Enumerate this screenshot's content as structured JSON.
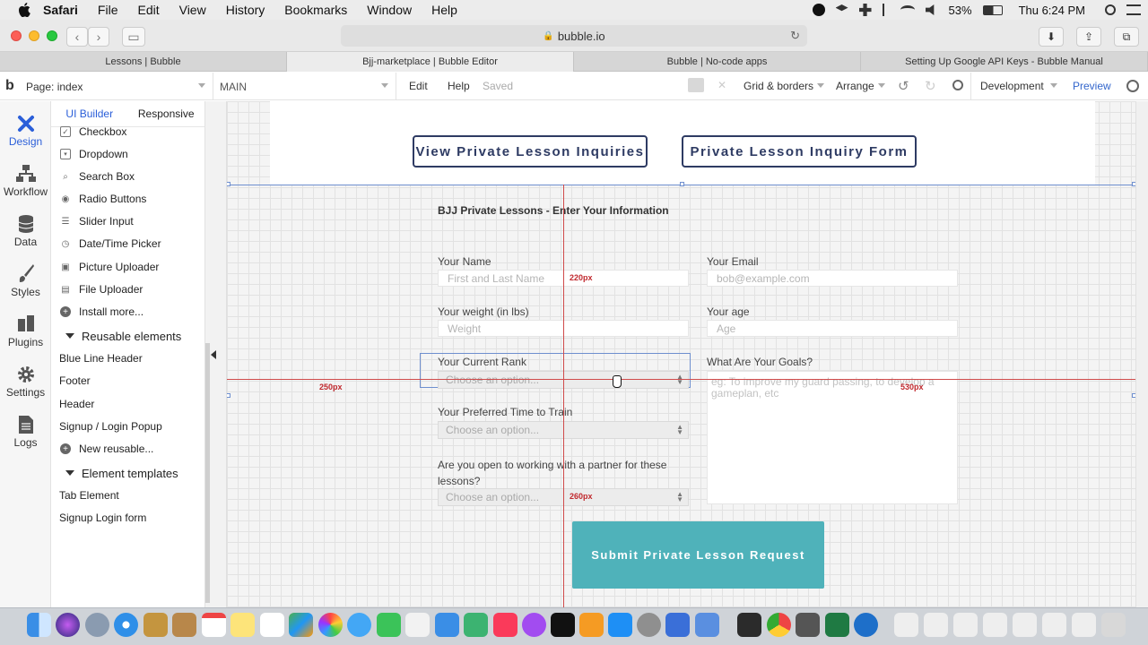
{
  "menubar": {
    "app": "Safari",
    "items": [
      "File",
      "Edit",
      "View",
      "History",
      "Bookmarks",
      "Window",
      "Help"
    ],
    "battery": "53%",
    "clock": "Thu 6:24 PM"
  },
  "browser": {
    "url": "bubble.io",
    "tabs": [
      "Lessons | Bubble",
      "Bjj-marketplace | Bubble Editor",
      "Bubble | No-code apps",
      "Setting Up Google API Keys - Bubble Manual"
    ],
    "active_tab": 1
  },
  "editor_header": {
    "logo": "b",
    "page": "Page: index",
    "main": "MAIN",
    "edit": "Edit",
    "help": "Help",
    "saved": "Saved",
    "grid": "Grid & borders",
    "arrange": "Arrange",
    "env": "Development",
    "preview": "Preview"
  },
  "left_nav": [
    {
      "label": "Design",
      "icon": "design-icon"
    },
    {
      "label": "Workflow",
      "icon": "workflow-icon"
    },
    {
      "label": "Data",
      "icon": "data-icon"
    },
    {
      "label": "Styles",
      "icon": "styles-icon"
    },
    {
      "label": "Plugins",
      "icon": "plugins-icon"
    },
    {
      "label": "Settings",
      "icon": "settings-icon"
    },
    {
      "label": "Logs",
      "icon": "logs-icon"
    }
  ],
  "panel": {
    "tabs": [
      "UI Builder",
      "Responsive"
    ],
    "items": [
      {
        "label": "Checkbox",
        "icon": "checkbox-icon"
      },
      {
        "label": "Dropdown",
        "icon": "dropdown-icon"
      },
      {
        "label": "Search Box",
        "icon": "search-icon"
      },
      {
        "label": "Radio Buttons",
        "icon": "radio-icon"
      },
      {
        "label": "Slider Input",
        "icon": "slider-icon"
      },
      {
        "label": "Date/Time Picker",
        "icon": "clock-icon"
      },
      {
        "label": "Picture Uploader",
        "icon": "picture-icon"
      },
      {
        "label": "File Uploader",
        "icon": "file-icon"
      },
      {
        "label": "Install more...",
        "icon": "plus-icon"
      }
    ],
    "reusable_title": "Reusable elements",
    "reusable": [
      "Blue Line Header",
      "Footer",
      "Header",
      "Signup / Login Popup",
      "New reusable..."
    ],
    "templates_title": "Element templates",
    "templates": [
      "Tab Element",
      "Signup Login form"
    ]
  },
  "canvas": {
    "btn_view": "View Private Lesson Inquiries",
    "btn_form": "Private Lesson Inquiry Form",
    "form_title": "BJJ Private Lessons - Enter Your Information",
    "name_label": "Your Name",
    "name_placeholder": "First and Last Name",
    "email_label": "Your Email",
    "email_placeholder": "bob@example.com",
    "weight_label": "Your weight (in lbs)",
    "weight_placeholder": "Weight",
    "age_label": "Your age",
    "age_placeholder": "Age",
    "rank_label": "Your Current Rank",
    "rank_value": "Choose an option...",
    "goals_label": "What Are Your Goals?",
    "goals_placeholder": "eg: To improve my guard passing, to develop a gameplan, etc",
    "time_label": "Your Preferred Time to Train",
    "time_value": "Choose an option...",
    "partner_label": "Are you open to working with a partner for these lessons?",
    "partner_value": "Choose an option...",
    "submit": "Submit Private Lesson Request",
    "dim_220": "220px",
    "dim_250": "250px",
    "dim_530": "530px",
    "dim_260": "260px"
  },
  "colors": {
    "accent": "#2b5fd9",
    "button_border": "#2e3b63",
    "submit": "#4fb2ba",
    "guide": "#d04b4b"
  }
}
